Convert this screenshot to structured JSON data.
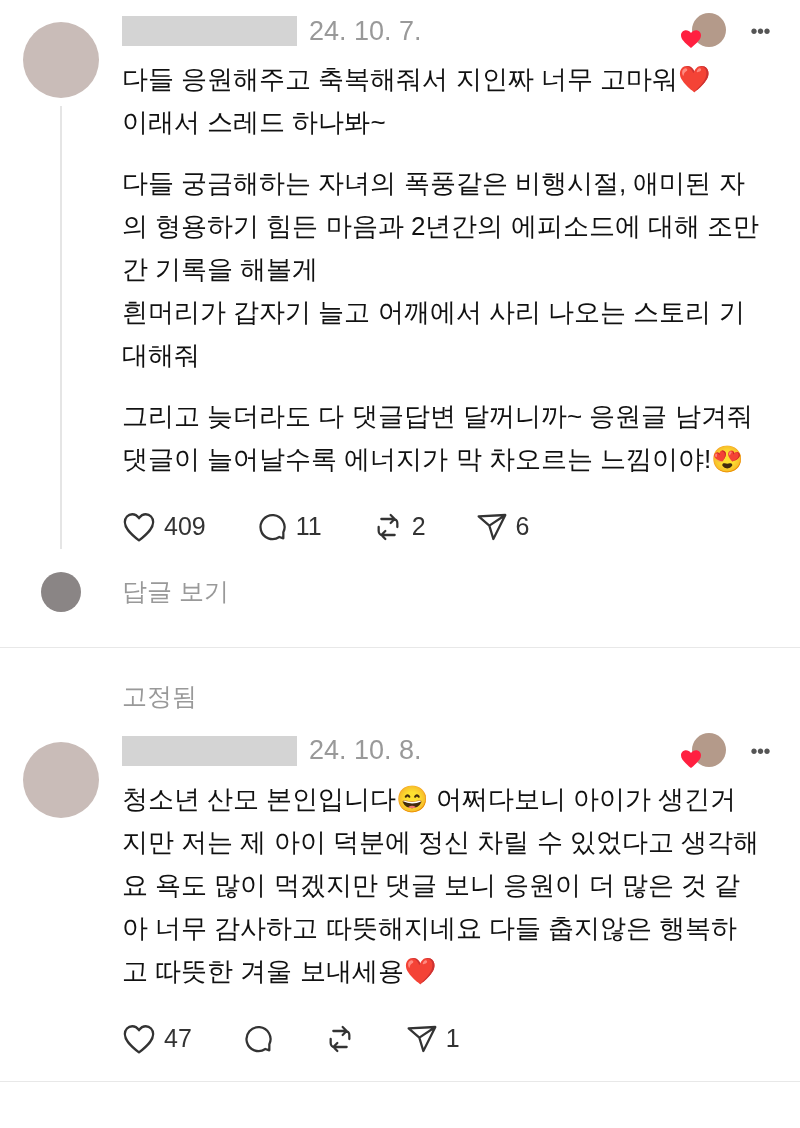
{
  "posts": [
    {
      "date": "24. 10. 7.",
      "liked_by_author": true,
      "menu": "•••",
      "paragraphs": [
        "다들 응원해주고 축복해줘서 지인짜 너무 고마워❤️\n이래서 스레드 하나봐~",
        "다들 궁금해하는 자녀의 폭풍같은 비행시절, 애미된 자의 형용하기 힘든 마음과 2년간의 에피소드에 대해 조만간 기록을 해볼게\n흰머리가 갑자기 늘고 어깨에서 사리 나오는 스토리 기대해줘",
        "그리고 늦더라도 다 댓글답변 달꺼니까~ 응원글 남겨줘\n댓글이 늘어날수록 에너지가 막 차오르는 느낌이야!😍"
      ],
      "stats": {
        "likes": "409",
        "replies": "11",
        "reposts": "2",
        "shares": "6"
      },
      "view_replies": "답글 보기"
    },
    {
      "pinned_label": "고정됨",
      "date": "24. 10. 8.",
      "liked_by_author": true,
      "menu": "•••",
      "paragraphs": [
        "청소년 산모 본인입니다😄 어쩌다보니 아이가 생긴거지만 저는 제 아이 덕분에 정신 차릴 수 있었다고 생각해요 욕도 많이 먹겠지만 댓글 보니 응원이 더 많은 것 같아 너무 감사하고 따뜻해지네요 다들 춥지않은 행복하고 따뜻한 겨울 보내세용❤️"
      ],
      "stats": {
        "likes": "47",
        "shares": "1"
      }
    }
  ]
}
